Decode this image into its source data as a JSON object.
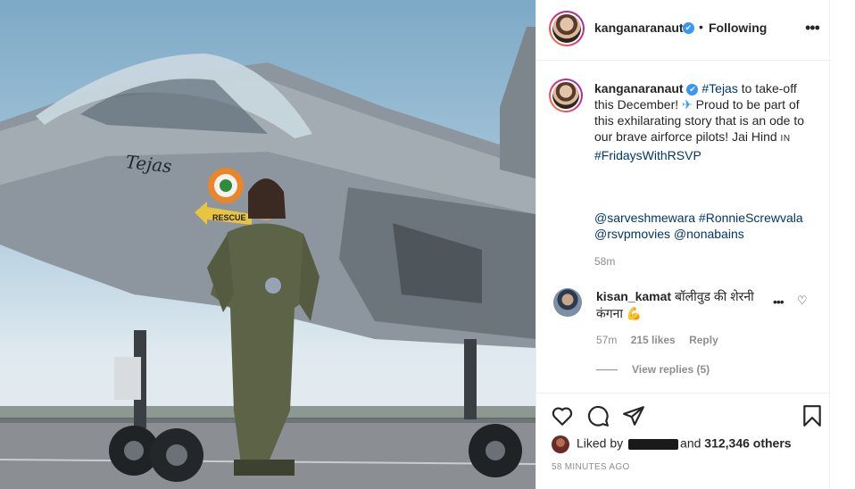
{
  "media": {
    "tail_text": "Tejas",
    "rescue_label": "RESCUE"
  },
  "post_header": {
    "username": "kanganaranaut",
    "verified": "✔",
    "separator": "•",
    "follow_status": "Following",
    "more": "•••"
  },
  "caption": {
    "username": "kanganaranaut",
    "hashtag_tejas": "#Tejas",
    "text_part1": " to take-off this December! ",
    "plane_emoji": "✈",
    "text_part2": " Proud to be part of this exhilarating story that is an ode to our brave airforce pilots! Jai Hind ",
    "in_text": "IN",
    "hashtag_fridays": "#FridaysWithRSVP",
    "mention_1": "@sarveshmewara",
    "hashtag_ronnie": "#RonnieScrewvala",
    "mention_2": "@rsvpmovies",
    "mention_3": "@nonabains",
    "time": "58m"
  },
  "comment": {
    "username": "kisan_kamat",
    "text": "बॉलीवुड की शेरनी कंगना",
    "emoji": "💪",
    "time": "57m",
    "likes": "215 likes",
    "reply": "Reply",
    "view_replies": "View replies (5)",
    "more": "•••",
    "heart": "♡"
  },
  "actions": {
    "liked_by_prefix": "Liked by",
    "liked_by_suffix": "and",
    "others": "312,346 others",
    "post_age": "58 MINUTES AGO"
  },
  "colors": {
    "link": "#00376b",
    "muted": "#8e8e8e",
    "verified": "#3897f0",
    "text": "#262626"
  }
}
